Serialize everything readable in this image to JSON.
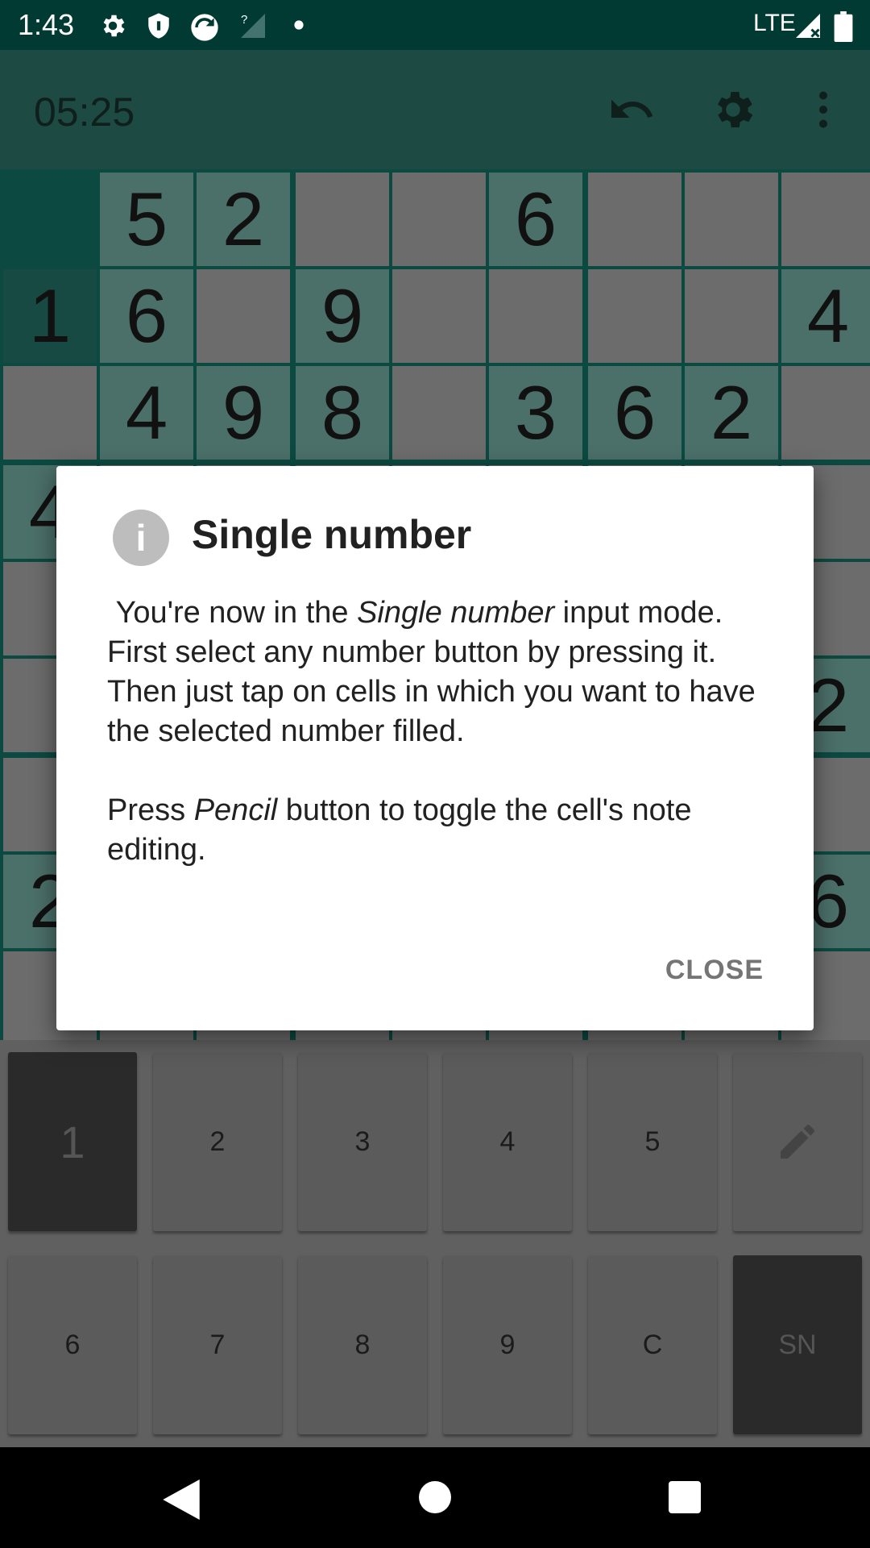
{
  "status_bar": {
    "time": "1:43",
    "network": "LTE",
    "icons": [
      "gear-icon",
      "shield-icon",
      "sync-icon",
      "no-signal-icon",
      "dot-icon",
      "signal-icon",
      "battery-icon"
    ]
  },
  "app_bar": {
    "timer": "05:25",
    "icons": [
      "undo-icon",
      "settings-icon",
      "more-vert-icon"
    ]
  },
  "board": {
    "rows": [
      [
        "",
        "5",
        "2",
        "",
        "",
        "6",
        "",
        "",
        ""
      ],
      [
        "1",
        "6",
        "",
        "9",
        "",
        "",
        "",
        "",
        "4"
      ],
      [
        "",
        "4",
        "9",
        "8",
        "",
        "3",
        "6",
        "2",
        ""
      ],
      [
        "4",
        "",
        "",
        "",
        "",
        "",
        "",
        "",
        ""
      ],
      [
        "",
        "",
        "",
        "",
        "",
        "",
        "",
        "",
        ""
      ],
      [
        "",
        "",
        "",
        "",
        "",
        "",
        "",
        "",
        "2"
      ],
      [
        "",
        "",
        "",
        "",
        "",
        "",
        "",
        "",
        ""
      ],
      [
        "2",
        "",
        "",
        "",
        "",
        "",
        "",
        "",
        "6"
      ],
      [
        "",
        "",
        "",
        "",
        "",
        "",
        "",
        "",
        ""
      ]
    ]
  },
  "keypad": {
    "row1": [
      "1",
      "2",
      "3",
      "4",
      "5"
    ],
    "row2": [
      "6",
      "7",
      "8",
      "9",
      "C",
      "SN"
    ],
    "pencil_icon": "pencil-icon"
  },
  "dialog": {
    "icon": "info-icon",
    "icon_glyph": "i",
    "title": "Single number",
    "p1_pre": "You're now in the ",
    "p1_em": "Single number",
    "p1_post": " input mode. First select any number button by pressing it. Then just tap on cells in which you want to have the selected number filled.",
    "p2_pre": "Press ",
    "p2_em": "Pencil",
    "p2_post": " button to toggle the cell's note editing.",
    "close_label": "CLOSE"
  },
  "nav_bar": {
    "icons": [
      "back-icon",
      "home-icon",
      "recents-icon"
    ]
  },
  "colors": {
    "status_bar": "#003a33",
    "app_bar": "#1e4a44",
    "board_lines": "#0c4a41",
    "cell_empty": "#6c6c6c",
    "cell_given": "#4b6f69",
    "cell_selected": "#174a42"
  }
}
